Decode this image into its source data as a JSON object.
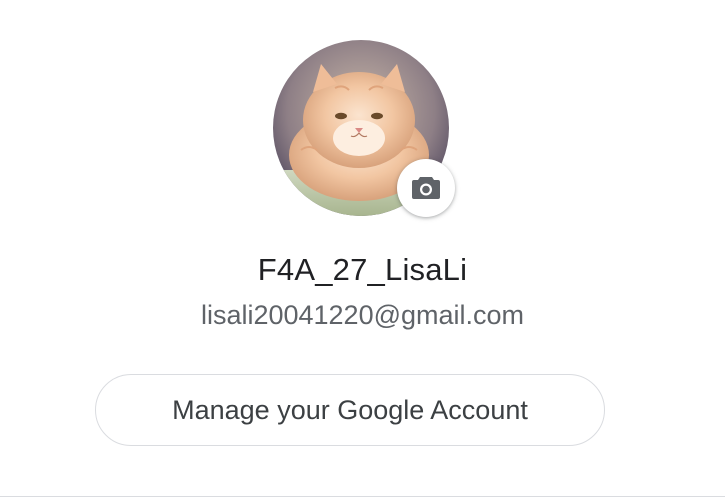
{
  "account": {
    "name": "F4A_27_LisaLi",
    "email": "lisali20041220@gmail.com",
    "avatar_icon": "cat-photo",
    "change_photo_icon": "camera-icon"
  },
  "actions": {
    "manage_account_label": "Manage your Google Account"
  },
  "colors": {
    "name_text": "#202124",
    "email_text": "#5f6368",
    "button_text": "#3c4043",
    "button_border": "#dadce0",
    "divider": "#dadce0"
  }
}
